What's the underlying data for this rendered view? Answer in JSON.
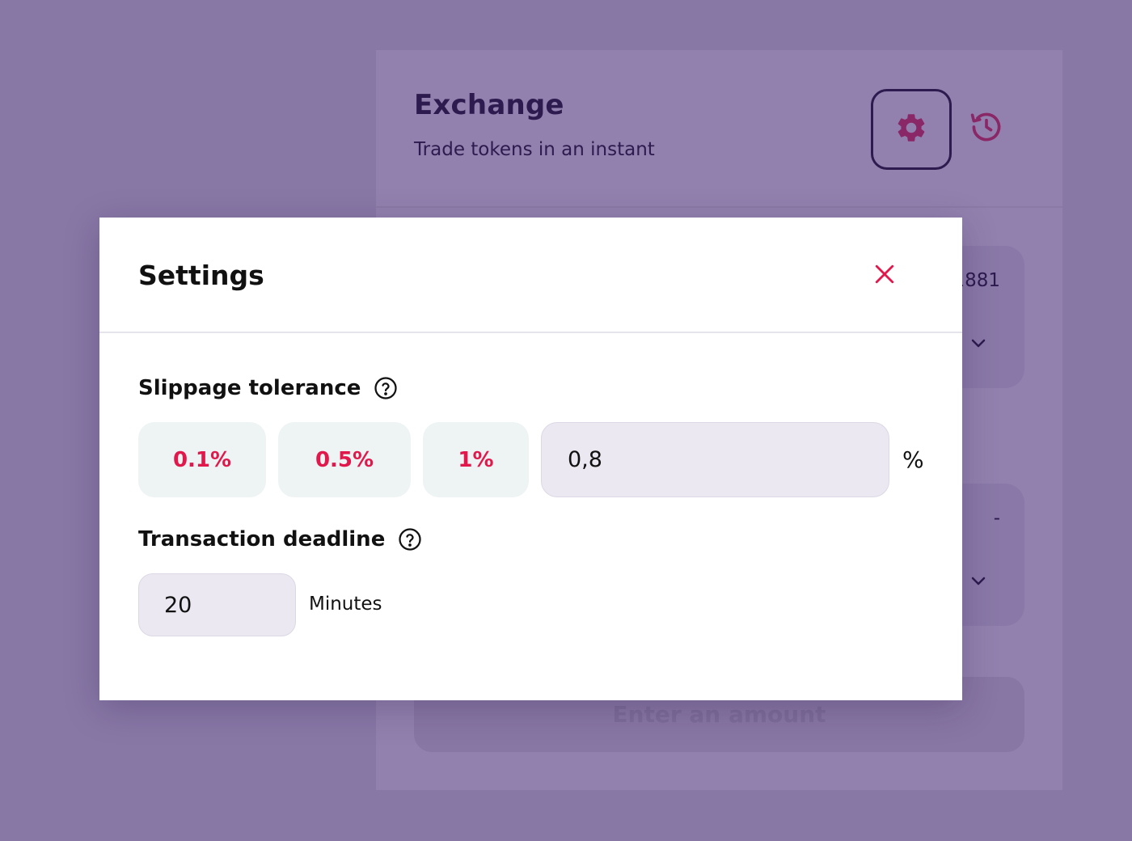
{
  "exchange": {
    "title": "Exchange",
    "subtitle": "Trade tokens in an instant",
    "settings_icon": "gear-icon",
    "history_icon": "history-icon",
    "from_panel": {
      "balance_partial": "1881"
    },
    "to_panel": {
      "balance_partial": "-"
    },
    "submit_label": "Enter an amount"
  },
  "settings": {
    "title": "Settings",
    "close_icon": "close-icon",
    "slippage": {
      "label": "Slippage tolerance",
      "presets": [
        "0.1%",
        "0.5%",
        "1%"
      ],
      "custom_value": "0,8",
      "unit": "%"
    },
    "deadline": {
      "label": "Transaction deadline",
      "value": "20",
      "unit": "Minutes"
    }
  },
  "colors": {
    "backdrop": "#8878a6",
    "accent_red": "#e0184b",
    "brand_purple": "#2d1a4e",
    "gear_magenta": "#8a2766"
  }
}
